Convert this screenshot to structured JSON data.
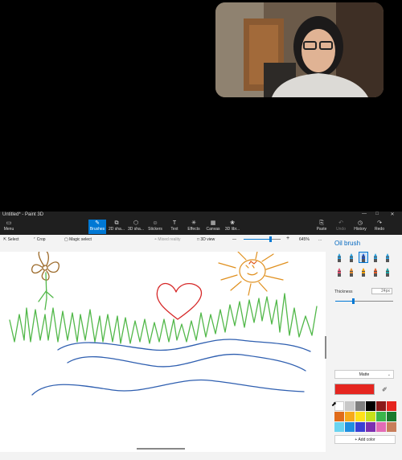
{
  "app": {
    "title": "Untitled* - Paint 3D",
    "window_controls": [
      "—",
      "□",
      "✕"
    ]
  },
  "ribbon": {
    "menu": {
      "icon": "menu-icon",
      "label": "Menu"
    },
    "tools": [
      {
        "label": "Brushes",
        "icon": "brush-icon",
        "glyph": "✎",
        "active": true
      },
      {
        "label": "2D sha...",
        "icon": "2d-shapes-icon",
        "glyph": "⧉",
        "active": false
      },
      {
        "label": "3D sha...",
        "icon": "3d-shapes-icon",
        "glyph": "⬡",
        "active": false
      },
      {
        "label": "Stickers",
        "icon": "stickers-icon",
        "glyph": "☺",
        "active": false
      },
      {
        "label": "Text",
        "icon": "text-icon",
        "glyph": "T",
        "active": false
      },
      {
        "label": "Effects",
        "icon": "effects-icon",
        "glyph": "✳",
        "active": false
      },
      {
        "label": "Canvas",
        "icon": "canvas-icon",
        "glyph": "▦",
        "active": false
      },
      {
        "label": "3D libr...",
        "icon": "3d-library-icon",
        "glyph": "❀",
        "active": false
      }
    ],
    "actions": [
      {
        "label": "Paste",
        "icon": "paste-icon",
        "glyph": "⎘",
        "disabled": false
      },
      {
        "label": "Undo",
        "icon": "undo-icon",
        "glyph": "↶",
        "disabled": true
      },
      {
        "label": "History",
        "icon": "history-icon",
        "glyph": "◷",
        "disabled": false
      },
      {
        "label": "Redo",
        "icon": "redo-icon",
        "glyph": "↷",
        "disabled": false
      }
    ]
  },
  "toolbar": {
    "select": "Select",
    "crop": "Crop",
    "magic_select": "Magic select",
    "mixed_reality": "Mixed reality",
    "view_3d": "3D view",
    "zoom_minus": "—",
    "zoom_plus": "+",
    "zoom_value": "645%",
    "zoom_level": 0.72,
    "more": "..."
  },
  "panel": {
    "title": "Oil brush",
    "thickness_label": "Thickness",
    "thickness_value": "24px",
    "thickness_level": 0.3,
    "finish": "Matte",
    "add_color": "+ Add color",
    "current_color": "#e5251f",
    "brushes": [
      {
        "name": "marker-brush",
        "color": "#2b9bd8"
      },
      {
        "name": "calligraphy-pen-brush",
        "color": "#2b9bd8"
      },
      {
        "name": "oil-brush",
        "color": "#1f4fbf"
      },
      {
        "name": "watercolor-brush",
        "color": "#2b9bd8"
      },
      {
        "name": "pixel-pen-brush",
        "color": "#2b9bd8"
      },
      {
        "name": "pencil-brush",
        "color": "#e05070"
      },
      {
        "name": "eraser-brush",
        "color": "#e08a30"
      },
      {
        "name": "crayon-brush",
        "color": "#f0a000"
      },
      {
        "name": "spray-can-brush",
        "color": "#e05a2a"
      },
      {
        "name": "fill-brush",
        "color": "#1aa0a0"
      }
    ],
    "swatches": [
      "#ffffff",
      "#c8c8c8",
      "#7f7f7f",
      "#000000",
      "#8b1a1a",
      "#e5251f",
      "#e06b1a",
      "#f7a91b",
      "#ffe11a",
      "#c6e01a",
      "#39b54a",
      "#1a7a2e",
      "#6ad4f0",
      "#1f8fe0",
      "#3a3fd4",
      "#7b2fb0",
      "#e36bb6",
      "#c87d5a"
    ]
  }
}
